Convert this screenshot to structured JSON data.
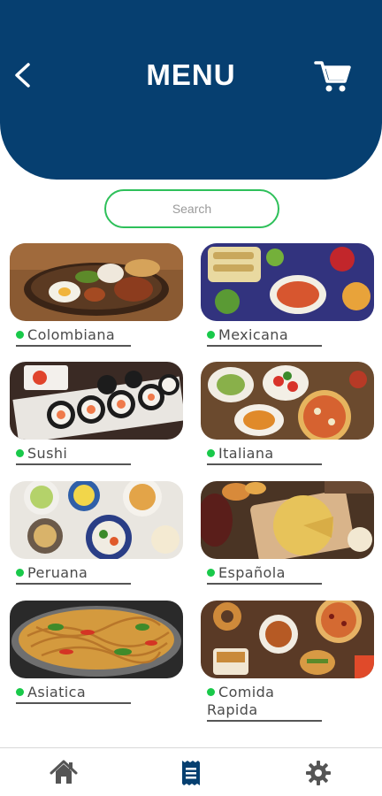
{
  "header": {
    "title": "MENU",
    "back_icon": "chevron-left-icon",
    "cart_icon": "cart-icon",
    "background": "#063f70"
  },
  "search": {
    "placeholder": "Search",
    "border_color": "#2ec05a"
  },
  "categories": [
    {
      "label": "Colombiana",
      "selected_dot_color": "#19c94a"
    },
    {
      "label": "Mexicana"
    },
    {
      "label": "Sushi"
    },
    {
      "label": "Italiana"
    },
    {
      "label": "Peruana"
    },
    {
      "label": "Española"
    },
    {
      "label": "Asiatica"
    },
    {
      "label": "Comida Rapida"
    }
  ],
  "bottom_nav": {
    "items": [
      {
        "icon": "home-icon"
      },
      {
        "icon": "receipt-icon",
        "active": true
      },
      {
        "icon": "gear-icon"
      }
    ],
    "inactive_color": "#555555",
    "active_color": "#063f70"
  }
}
